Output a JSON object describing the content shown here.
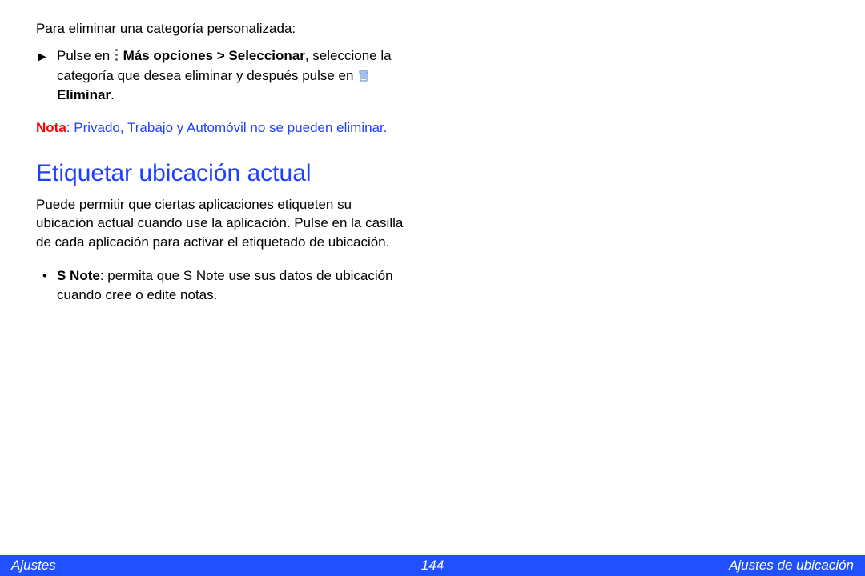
{
  "content": {
    "intro": "Para eliminar una categoría personalizada:",
    "step": {
      "part1": "Pulse en ",
      "bold1": "Más opciones > Seleccionar",
      "part2": ", seleccione la categoría que desea eliminar y después pulse en ",
      "bold2": "Eliminar",
      "part3": "."
    },
    "note": {
      "label": "Nota",
      "colon": ": ",
      "body": "Privado, Trabajo y Automóvil no se pueden eliminar."
    },
    "heading": "Etiquetar ubicación actual",
    "body": "Puede permitir que ciertas aplicaciones etiqueten su ubicación actual cuando use la aplicación. Pulse en la casilla de cada aplicación para activar el etiquetado de ubicación.",
    "bullet": {
      "bold": "S Note",
      "text": ": permita que S Note use sus datos de ubicación cuando cree o edite notas."
    }
  },
  "footer": {
    "left": "Ajustes",
    "center": "144",
    "right": "Ajustes de ubicación"
  }
}
